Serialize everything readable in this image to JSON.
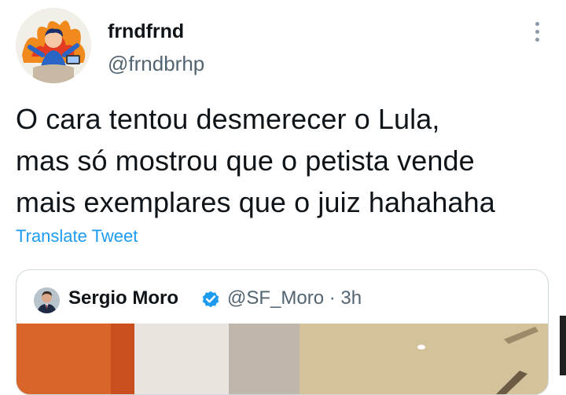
{
  "author": {
    "display_name": "frndfrnd",
    "handle": "@frndbrhp",
    "avatar_icon": "cartoon-avatar-icon"
  },
  "tweet": {
    "lines": [
      "O cara tentou desmerecer o Lula,",
      "mas só mostrou que o petista vende",
      "mais exemplares que o juiz hahahaha"
    ],
    "translate_label": "Translate Tweet"
  },
  "quoted": {
    "display_name": "Sergio Moro",
    "meta": "@SF_Moro · 3h",
    "verified_icon": "verified-badge-icon",
    "avatar_icon": "profile-photo-icon"
  },
  "colors": {
    "link": "#1d9bf0",
    "text": "#0f1419",
    "secondary": "#536471",
    "border": "#cfd9de"
  }
}
